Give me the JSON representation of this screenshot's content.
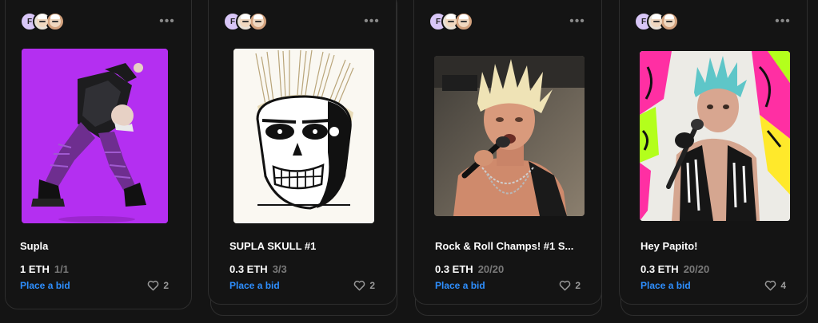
{
  "menu_icon": "more-horizontal-icon",
  "like_icon": "heart-outline-icon",
  "colors": {
    "background": "#141414",
    "card_border": "#2e2e2e",
    "bid_link": "#2e8fff",
    "muted": "#7a7a7a"
  },
  "cards": [
    {
      "title": "Supla",
      "price": "1 ETH",
      "edition": "1/1",
      "bid_label": "Place a bid",
      "likes": "2"
    },
    {
      "title": "SUPLA SKULL #1",
      "price": "0.3 ETH",
      "edition": "3/3",
      "bid_label": "Place a bid",
      "likes": "2"
    },
    {
      "title": "Rock & Roll Champs! #1 S...",
      "price": "0.3 ETH",
      "edition": "20/20",
      "bid_label": "Place a bid",
      "likes": "2"
    },
    {
      "title": "Hey Papito!",
      "price": "0.3 ETH",
      "edition": "20/20",
      "bid_label": "Place a bid",
      "likes": "4"
    }
  ]
}
